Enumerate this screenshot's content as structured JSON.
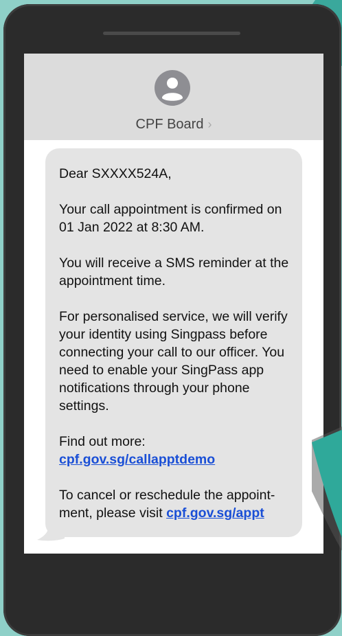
{
  "contact": {
    "name": "CPF Board",
    "chevron": "›"
  },
  "message": {
    "greeting": "Dear SXXXX524A,",
    "confirm": "Your call appointment is confirmed on 01 Jan 2022 at 8:30 AM.",
    "reminder": "You will receive a SMS reminder at the appointment time.",
    "service": "For personalised service, we will verify your identity using Singpass before connecting your call to our officer. You need to enable your SingPass app notifications through your phone settings.",
    "find_more_label": "Find out more:",
    "find_more_link": "cpf.gov.sg/callapptdemo",
    "cancel_text": "To cancel or reschedule the appoint-ment, please visit",
    "cancel_link": "cpf.gov.sg/appt"
  },
  "colors": {
    "background": "#8fd0c8",
    "accent": "#3aa89c",
    "link": "#1a4fd6"
  },
  "icons": {
    "avatar": "person-silhouette-icon",
    "chevron": "chevron-right-icon"
  }
}
